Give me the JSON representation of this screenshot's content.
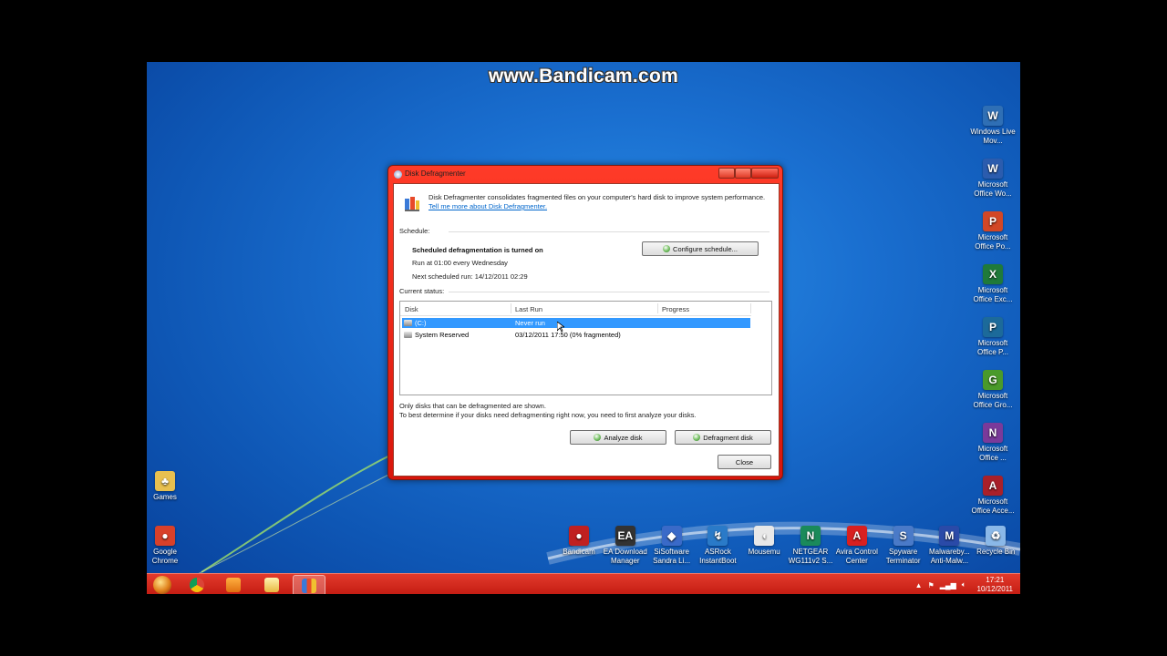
{
  "watermark": "www.Bandicam.com",
  "desktop_icons_right": [
    {
      "name": "windows-live-movie-maker",
      "label": "Windows Live Mov...",
      "color": "#2f6fb5",
      "glyph": "W"
    },
    {
      "name": "microsoft-office-word",
      "label": "Microsoft Office Wo...",
      "color": "#2b5cae",
      "glyph": "W"
    },
    {
      "name": "microsoft-office-powerpoint",
      "label": "Microsoft Office Po...",
      "color": "#d24726",
      "glyph": "P"
    },
    {
      "name": "microsoft-office-excel",
      "label": "Microsoft Office Exc...",
      "color": "#1f7a3a",
      "glyph": "X"
    },
    {
      "name": "microsoft-office-publisher",
      "label": "Microsoft Office P...",
      "color": "#1c6a9a",
      "glyph": "P"
    },
    {
      "name": "microsoft-office-groove",
      "label": "Microsoft Office Gro...",
      "color": "#4a9a2a",
      "glyph": "G"
    },
    {
      "name": "microsoft-office-onenote",
      "label": "Microsoft Office ...",
      "color": "#7a3a9a",
      "glyph": "N"
    },
    {
      "name": "microsoft-office-access",
      "label": "Microsoft Office Acce...",
      "color": "#a8202a",
      "glyph": "A"
    }
  ],
  "desktop_icons_left": [
    {
      "name": "games",
      "label": "Games",
      "color": "#e8c050",
      "glyph": "♣"
    },
    {
      "name": "google-chrome",
      "label": "Google Chrome",
      "color": "#d8402a",
      "glyph": "●"
    }
  ],
  "desktop_icons_bottom": [
    {
      "name": "bandicam",
      "label": "Bandicam",
      "color": "#c02020",
      "glyph": "●"
    },
    {
      "name": "ea-download-manager",
      "label": "EA Download Manager",
      "color": "#333333",
      "glyph": "EA"
    },
    {
      "name": "sisoftware-sandra",
      "label": "SiSoftware Sandra Li...",
      "color": "#3a6ac8",
      "glyph": "◆"
    },
    {
      "name": "asrock-instantboot",
      "label": "ASRock InstantBoot",
      "color": "#2a7ac8",
      "glyph": "↯"
    },
    {
      "name": "mousemu",
      "label": "Mousemu",
      "color": "#e8e8e8",
      "glyph": "◖"
    },
    {
      "name": "netgear-wg111v2",
      "label": "NETGEAR WG111v2 S...",
      "color": "#1a8a5a",
      "glyph": "N"
    },
    {
      "name": "avira-control-center",
      "label": "Avira Control Center",
      "color": "#d82020",
      "glyph": "A"
    },
    {
      "name": "spyware-terminator",
      "label": "Spyware Terminator",
      "color": "#4a7ac8",
      "glyph": "S"
    },
    {
      "name": "malwarebytes",
      "label": "Malwareby... Anti-Malw...",
      "color": "#2a4aa8",
      "glyph": "M"
    },
    {
      "name": "recycle-bin",
      "label": "Recycle Bin",
      "color": "#8ab8e8",
      "glyph": "♻"
    }
  ],
  "dialog": {
    "title": "Disk Defragmenter",
    "intro_text": "Disk Defragmenter consolidates fragmented files on your computer's hard disk to improve system performance.",
    "intro_link": "Tell me more about Disk Defragmenter.",
    "schedule_label": "Schedule:",
    "schedule_title": "Scheduled defragmentation is turned on",
    "schedule_run": "Run at 01:00 every Wednesday",
    "schedule_next": "Next scheduled run: 14/12/2011 02:29",
    "configure_button": "Configure schedule...",
    "current_status_label": "Current status:",
    "table": {
      "headers": [
        "Disk",
        "Last Run",
        "Progress"
      ],
      "rows": [
        {
          "disk": "(C:)",
          "last_run": "Never run",
          "progress": "",
          "selected": true
        },
        {
          "disk": "System Reserved",
          "last_run": "03/12/2011 17:50 (0% fragmented)",
          "progress": "",
          "selected": false
        }
      ]
    },
    "note1": "Only disks that can be defragmented are shown.",
    "note2": "To best determine if your disks need defragmenting right now, you need to first analyze your disks.",
    "analyze_button": "Analyze disk",
    "defragment_button": "Defragment disk",
    "close_button": "Close"
  },
  "taskbar": {
    "clock_time": "17:21",
    "clock_date": "10/12/2011"
  }
}
